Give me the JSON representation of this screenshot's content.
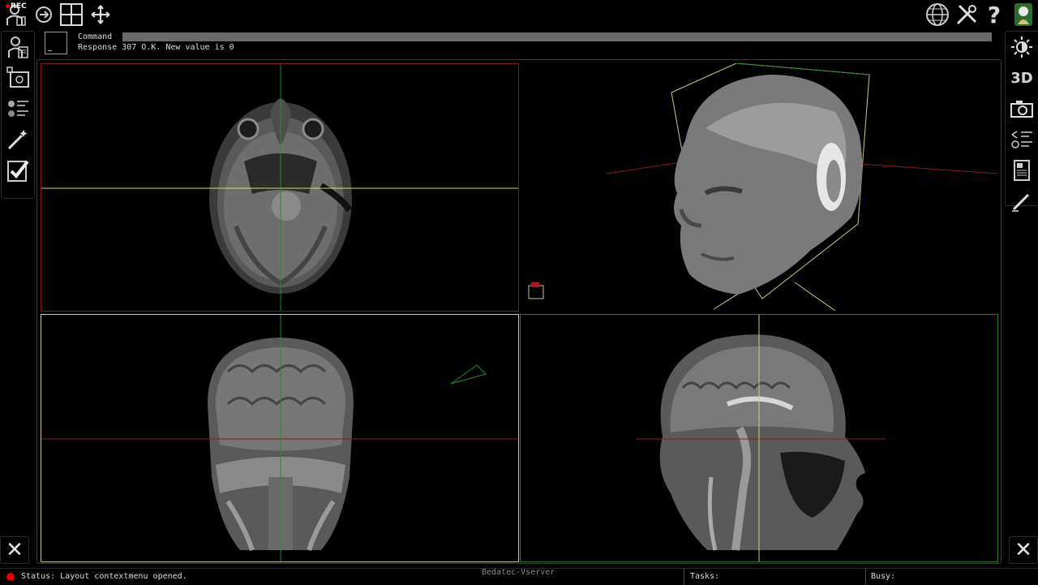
{
  "topbar": {
    "rec_label": "REC",
    "layout_icons": [
      "user-dicom-icon",
      "rotate-icon",
      "grid-layout-icon",
      "move-arrows-icon"
    ],
    "right_icons": [
      "globe-icon",
      "tools-icon",
      "help-icon",
      "bedatec-logo-icon"
    ]
  },
  "command": {
    "label": "Command",
    "input_value": "",
    "response": "Response 307 O.K. New value is 0"
  },
  "left_sidebar": {
    "icons": [
      "patient-record-icon",
      "screen-capture-icon",
      "organ-list-icon",
      "magic-wand-icon",
      "checklist-icon"
    ]
  },
  "right_sidebar": {
    "icons": [
      "brightness-icon",
      "3d-icon",
      "camera-icon",
      "layers-list-icon",
      "document-icon",
      "pen-icon"
    ],
    "label_3d": "3D"
  },
  "views": [
    {
      "name": "axial",
      "border_color": "#7a1a1a"
    },
    {
      "name": "3d-volume",
      "border_color": "none"
    },
    {
      "name": "coronal",
      "border_color": "#c9c98a"
    },
    {
      "name": "sagittal",
      "border_color": "#2f7a2f"
    }
  ],
  "status": {
    "status_text": "Status: Layout contextmenu opened.",
    "server_label": "Bedatec-Vserver",
    "tasks_label": "Tasks:",
    "busy_label": "Busy:",
    "status_dot_color": "#e00000"
  },
  "close_symbol": "✕"
}
